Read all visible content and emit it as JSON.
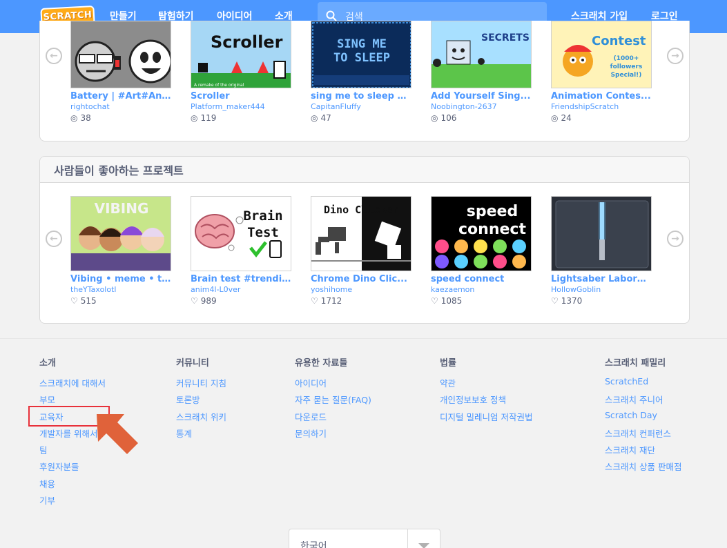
{
  "nav": {
    "logo": "SCRATCH",
    "links": [
      "만들기",
      "탐험하기",
      "아이디어",
      "소개"
    ],
    "search_placeholder": "검색",
    "join": "스크래치 가입",
    "login": "로그인"
  },
  "row1": {
    "projects": [
      {
        "title": "Battery | #Art#Ani...",
        "author": "rightochat",
        "stat": "38"
      },
      {
        "title": "Scroller",
        "author": "Platform_maker444",
        "stat": "119"
      },
      {
        "title": "sing me to sleep ↓...",
        "author": "CapitanFluffy",
        "stat": "47"
      },
      {
        "title": "Add Yourself Sing...",
        "author": "Noobington-2637",
        "stat": "106"
      },
      {
        "title": "Animation Contes...",
        "author": "FriendshipScratch",
        "stat": "24"
      }
    ]
  },
  "row2": {
    "heading": "사람들이 좋아하는 프로젝트",
    "projects": [
      {
        "title": "Vibing • meme • toh",
        "author": "theYTaxolotl",
        "stat": "515"
      },
      {
        "title": "Brain test #trendi...",
        "author": "anim4l-L0ver",
        "stat": "989"
      },
      {
        "title": "Chrome Dino Clic...",
        "author": "yoshihome",
        "stat": "1712"
      },
      {
        "title": "speed connect",
        "author": "kaezaemon",
        "stat": "1085"
      },
      {
        "title": "Lightsaber Labora...",
        "author": "HollowGoblin",
        "stat": "1370"
      }
    ]
  },
  "thumbs": {
    "scroller": "Scroller",
    "scroller_sub": "A remake of the original",
    "sing": [
      "SING ME",
      "TO SLEEP"
    ],
    "secrets": "SECRETS",
    "contest": "Contest",
    "contest_sub": [
      "(1000+",
      "followers",
      "Special!)"
    ],
    "vibing": "VIBING",
    "brain": [
      "Brain",
      "Test"
    ],
    "dino": "Dino Clicker",
    "speed": [
      "speed",
      "connect"
    ]
  },
  "footer": {
    "about": {
      "heading": "소개",
      "links": [
        "스크래치에 대해서",
        "부모",
        "교육자",
        "개발자를 위해서",
        "팀",
        "후원자분들",
        "채용",
        "기부"
      ]
    },
    "community": {
      "heading": "커뮤니티",
      "links": [
        "커뮤니티 지침",
        "토론방",
        "스크래치 위키",
        "통계"
      ]
    },
    "resources": {
      "heading": "유용한 자료들",
      "links": [
        "아이디어",
        "자주 묻는 질문(FAQ)",
        "다운로드",
        "문의하기"
      ]
    },
    "legal": {
      "heading": "법률",
      "links": [
        "약관",
        "개인정보보호 정책",
        "디지털 밀레니엄 저작권법"
      ]
    },
    "family": {
      "heading": "스크래치 패밀리",
      "links": [
        "ScratchEd",
        "스크래치 주니어",
        "Scratch Day",
        "스크래치 컨퍼런스",
        "스크래치 재단",
        "스크래치 상품 판매점"
      ]
    },
    "language": "한국어"
  },
  "colors": {
    "nav": "#4c97ff",
    "link": "#4c97ff",
    "annotation": "#e8313a",
    "arrow": "#e0623a"
  }
}
